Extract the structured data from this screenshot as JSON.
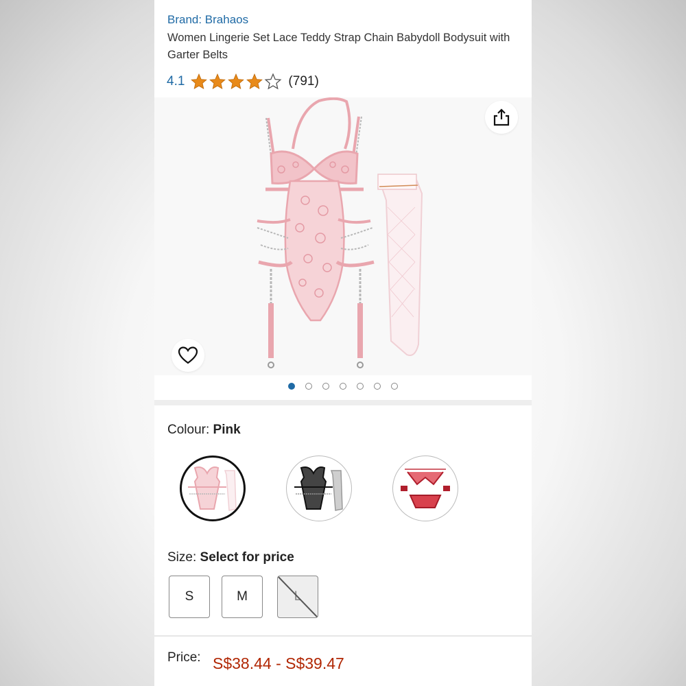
{
  "product": {
    "brand": "Brand: Brahaos",
    "title": "Women Lingerie Set Lace Teddy Strap Chain Babydoll Bodysuit with Garter Belts",
    "rating": "4.1",
    "rating_stars": 4.1,
    "review_count": "(791)"
  },
  "gallery": {
    "image_count": 7,
    "active_index": 0
  },
  "colour": {
    "label": "Colour:",
    "selected": "Pink",
    "options": [
      "pink-lace-bodysuit",
      "black-lace-bodysuit",
      "red-lace-bra-set"
    ]
  },
  "size": {
    "label": "Size:",
    "prompt": "Select for price",
    "options": [
      "S",
      "M",
      "L"
    ],
    "unavailable": [
      "L"
    ]
  },
  "price": {
    "label": "Price:",
    "value": "S$38.44 - S$39.47"
  },
  "icons": {
    "share": "share-icon",
    "wishlist": "heart-icon",
    "rating": "star-icon"
  },
  "colors": {
    "link": "#1f6aa5",
    "star": "#e88a1a",
    "price": "#b12704",
    "product_pink": "#e9a6ae"
  }
}
